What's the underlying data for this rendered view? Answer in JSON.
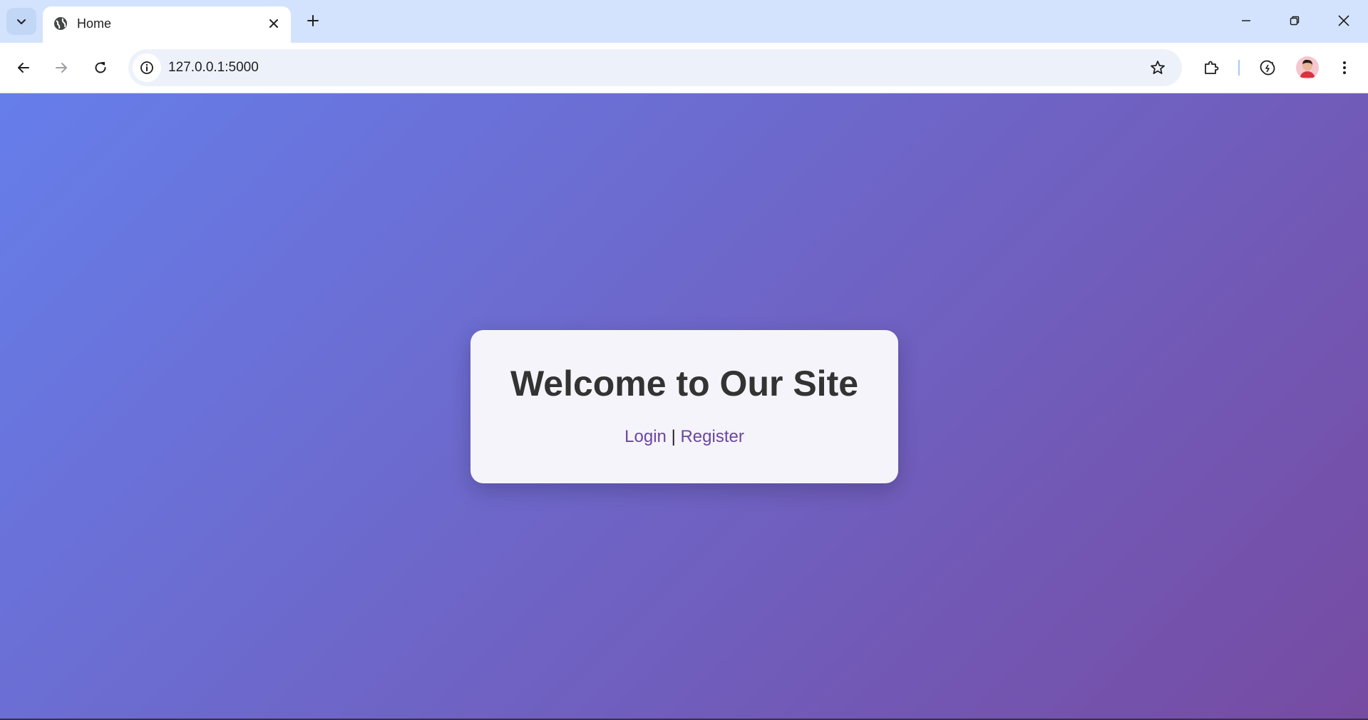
{
  "browser": {
    "tab": {
      "title": "Home",
      "favicon": "globe-icon"
    },
    "toolbar": {
      "url": "127.0.0.1:5000"
    },
    "icons": {
      "tab_search": "chevron-down-icon",
      "tab_close": "close-icon",
      "new_tab": "plus-icon",
      "minimize": "minimize-icon",
      "restore": "restore-icon",
      "close_window": "close-icon",
      "back": "back-arrow-icon",
      "forward": "forward-arrow-icon",
      "reload": "reload-icon",
      "site_info": "info-icon",
      "bookmark": "star-icon",
      "extensions": "puzzle-icon",
      "performance": "leaf-icon",
      "menu": "kebab-menu-icon"
    }
  },
  "page": {
    "heading": "Welcome to Our Site",
    "login_label": "Login",
    "separator": "|",
    "register_label": "Register"
  },
  "colors": {
    "gradient_start": "#667eea",
    "gradient_end": "#764ba2",
    "card_background": "#f5f4fa",
    "heading_text": "#333333",
    "link_color": "#6b46a0",
    "tabstrip": "#d3e3fd"
  }
}
